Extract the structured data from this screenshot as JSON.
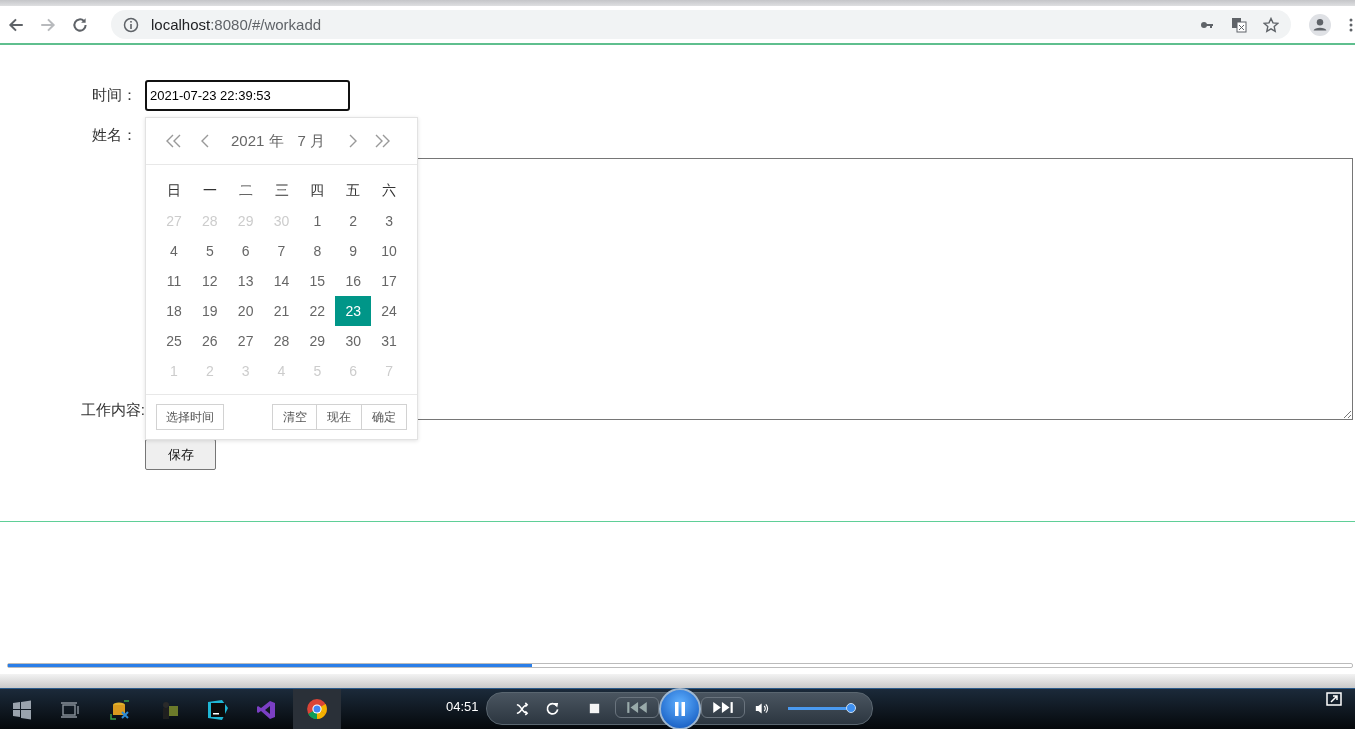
{
  "browser": {
    "url_host": "localhost",
    "url_rest": ":8080/#/workadd",
    "forward_disabled": true
  },
  "form": {
    "time_label": "时间：",
    "time_value": "2021-07-23 22:39:53",
    "name_label": "姓名：",
    "content_label": "工作内容:",
    "save": "保存"
  },
  "calendar": {
    "year": "2021 年",
    "month": "7 月",
    "weekdays": [
      "日",
      "一",
      "二",
      "三",
      "四",
      "五",
      "六"
    ],
    "days": [
      {
        "text": "27",
        "muted": true,
        "selected": false
      },
      {
        "text": "28",
        "muted": true,
        "selected": false
      },
      {
        "text": "29",
        "muted": true,
        "selected": false
      },
      {
        "text": "30",
        "muted": true,
        "selected": false
      },
      {
        "text": "1",
        "muted": false,
        "selected": false
      },
      {
        "text": "2",
        "muted": false,
        "selected": false
      },
      {
        "text": "3",
        "muted": false,
        "selected": false
      },
      {
        "text": "4",
        "muted": false,
        "selected": false
      },
      {
        "text": "5",
        "muted": false,
        "selected": false
      },
      {
        "text": "6",
        "muted": false,
        "selected": false
      },
      {
        "text": "7",
        "muted": false,
        "selected": false
      },
      {
        "text": "8",
        "muted": false,
        "selected": false
      },
      {
        "text": "9",
        "muted": false,
        "selected": false
      },
      {
        "text": "10",
        "muted": false,
        "selected": false
      },
      {
        "text": "11",
        "muted": false,
        "selected": false
      },
      {
        "text": "12",
        "muted": false,
        "selected": false
      },
      {
        "text": "13",
        "muted": false,
        "selected": false
      },
      {
        "text": "14",
        "muted": false,
        "selected": false
      },
      {
        "text": "15",
        "muted": false,
        "selected": false
      },
      {
        "text": "16",
        "muted": false,
        "selected": false
      },
      {
        "text": "17",
        "muted": false,
        "selected": false
      },
      {
        "text": "18",
        "muted": false,
        "selected": false
      },
      {
        "text": "19",
        "muted": false,
        "selected": false
      },
      {
        "text": "20",
        "muted": false,
        "selected": false
      },
      {
        "text": "21",
        "muted": false,
        "selected": false
      },
      {
        "text": "22",
        "muted": false,
        "selected": false
      },
      {
        "text": "23",
        "muted": false,
        "selected": true
      },
      {
        "text": "24",
        "muted": false,
        "selected": false
      },
      {
        "text": "25",
        "muted": false,
        "selected": false
      },
      {
        "text": "26",
        "muted": false,
        "selected": false
      },
      {
        "text": "27",
        "muted": false,
        "selected": false
      },
      {
        "text": "28",
        "muted": false,
        "selected": false
      },
      {
        "text": "29",
        "muted": false,
        "selected": false
      },
      {
        "text": "30",
        "muted": false,
        "selected": false
      },
      {
        "text": "31",
        "muted": false,
        "selected": false
      },
      {
        "text": "1",
        "muted": true,
        "selected": false
      },
      {
        "text": "2",
        "muted": true,
        "selected": false
      },
      {
        "text": "3",
        "muted": true,
        "selected": false
      },
      {
        "text": "4",
        "muted": true,
        "selected": false
      },
      {
        "text": "5",
        "muted": true,
        "selected": false
      },
      {
        "text": "6",
        "muted": true,
        "selected": false
      },
      {
        "text": "7",
        "muted": true,
        "selected": false
      }
    ],
    "select_time": "选择时间",
    "actions": [
      "清空",
      "现在",
      "确定"
    ]
  },
  "player": {
    "seek": {
      "level": 0.39
    },
    "time": "04:51",
    "playing": true,
    "volume": {
      "level": 0.93
    }
  }
}
